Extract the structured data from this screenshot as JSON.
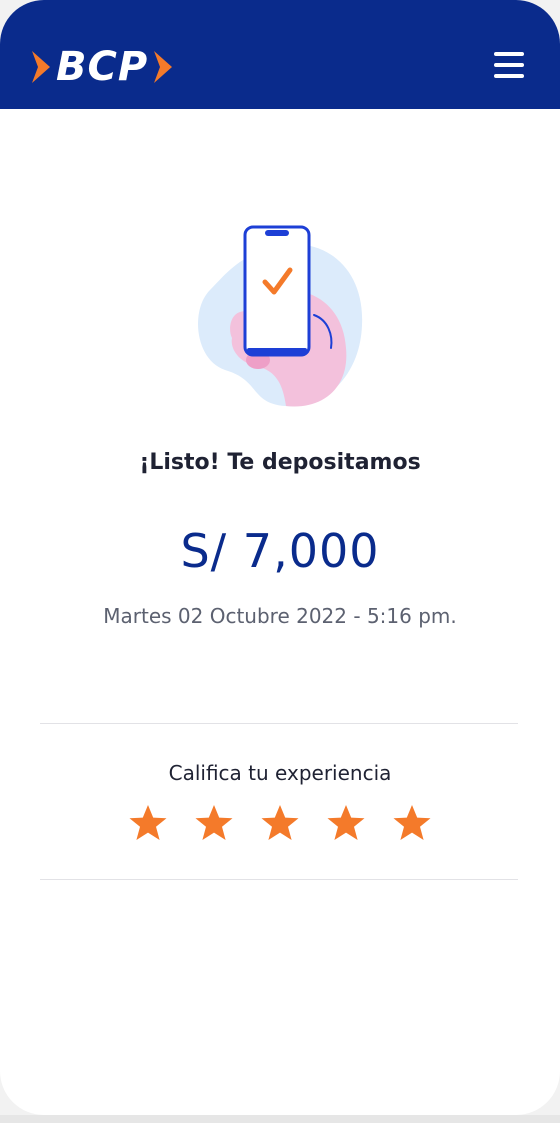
{
  "header": {
    "logo_text": "BCP",
    "menu_icon": "hamburger-menu-icon",
    "background_color": "#0a2b8c",
    "accent_color": "#f47a2a"
  },
  "illustration": {
    "icon": "phone-check-illustration"
  },
  "confirmation": {
    "title": "¡Listo! Te depositamos",
    "amount": "S/ 7,000",
    "datetime": "Martes 02 Octubre 2022 - 5:16 pm."
  },
  "rating": {
    "label": "Califica tu experiencia",
    "star_icon": "star-icon",
    "max": 5,
    "value": 5
  }
}
